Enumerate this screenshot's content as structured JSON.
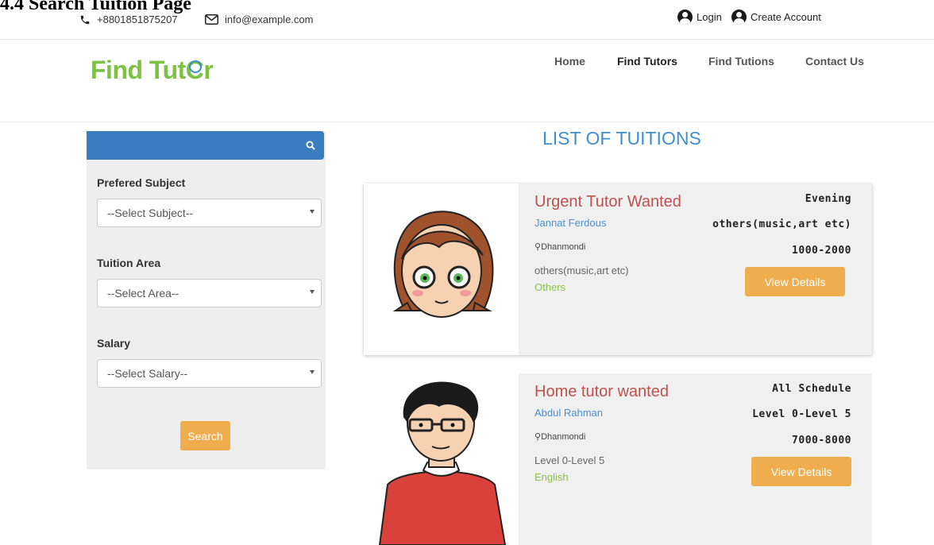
{
  "doc_caption": "4.4 Search Tuition Page",
  "topbar": {
    "phone": "+8801851875207",
    "email": "info@example.com",
    "login": "Login",
    "create_account": "Create Account"
  },
  "header": {
    "logo": {
      "part1": "Find Tut",
      "part2": "r"
    },
    "nav": [
      "Home",
      "Find Tutors",
      "Find Tutions",
      "Contact Us"
    ]
  },
  "sidebar": {
    "search_value": "",
    "fields": [
      {
        "label": "Prefered Subject",
        "placeholder": "--Select Subject--"
      },
      {
        "label": "Tuition Area",
        "placeholder": "--Select Area--"
      },
      {
        "label": "Salary",
        "placeholder": "--Select Salary--"
      }
    ],
    "search_button": "Search"
  },
  "list": {
    "title": "LIST OF TUITIONS",
    "items": [
      {
        "title": "Urgent Tutor Wanted",
        "name": "Jannat Ferdous",
        "location": "Dhanmondi",
        "level": "others(music,art etc)",
        "subject": "Others",
        "schedule": "Evening",
        "class": "others(music,art etc)",
        "salary": "1000-2000",
        "button": "View Details"
      },
      {
        "title": "Home tutor wanted",
        "name": "Abdul Rahman",
        "location": "Dhanmondi",
        "level": "Level 0-Level 5",
        "subject": "English",
        "schedule": "All Schedule",
        "class": "Level 0-Level 5",
        "salary": "7000-8000",
        "button": "View Details"
      }
    ]
  },
  "colors": {
    "primary_blue": "#3a7cc0",
    "accent_orange": "#f0ad4e",
    "logo_green": "#7cc142",
    "title_red": "#c0504d"
  }
}
